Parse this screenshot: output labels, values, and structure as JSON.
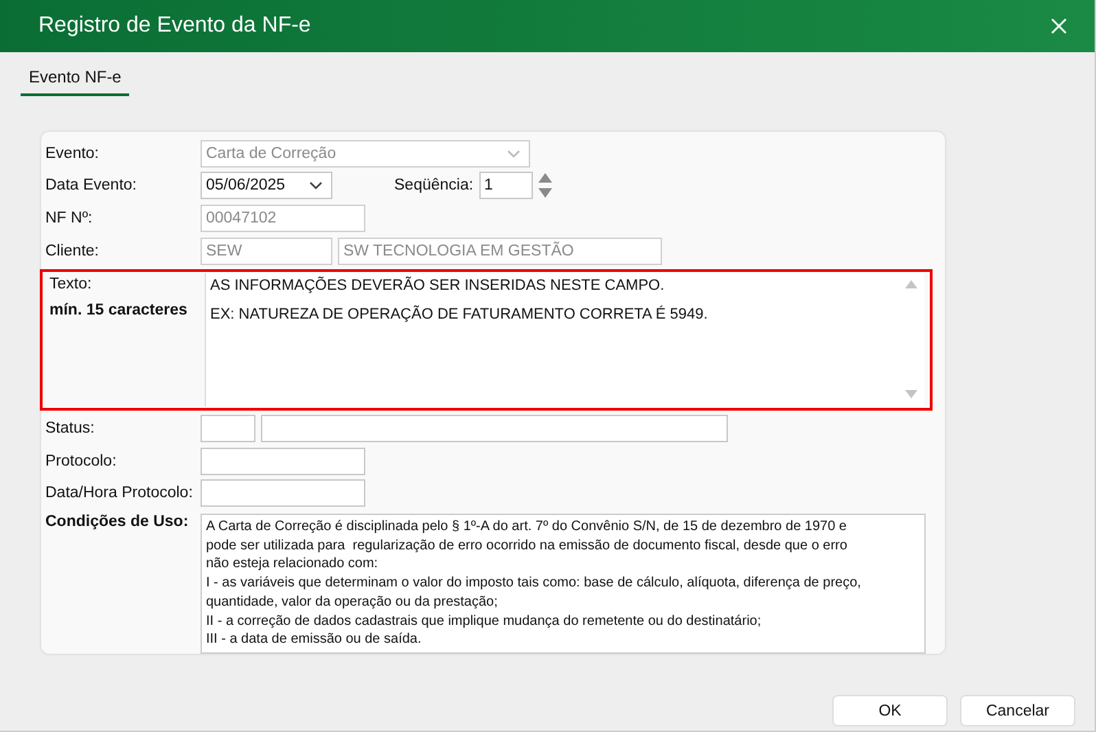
{
  "window": {
    "title": "Registro de Evento da NF-e"
  },
  "tabs": [
    {
      "label": "Evento NF-e",
      "selected": true
    }
  ],
  "rows_top": [
    {
      "label": "Evento:",
      "fields": [
        {
          "kind": "combo",
          "value": "Carta de Correção",
          "disabled": true
        }
      ]
    },
    {
      "label": "Data Evento:",
      "fields": [
        {
          "kind": "date",
          "value": "05/06/2025",
          "disabled": false
        },
        {
          "kind": "spin",
          "label": "Seqüência:",
          "value": "1",
          "disabled": false
        }
      ]
    },
    {
      "label": "NF Nº:",
      "fields": [
        {
          "kind": "text",
          "value": "00047102",
          "disabled": true
        }
      ]
    },
    {
      "label": "Cliente:",
      "fields": [
        {
          "kind": "text",
          "value": "SEW",
          "disabled": true
        },
        {
          "kind": "text",
          "value": "SW TECNOLOGIA EM GESTÃO",
          "disabled": true
        }
      ]
    }
  ],
  "texto": {
    "label": "Texto:",
    "hint": "mín. 15 caracteres",
    "highlighted": true,
    "lines": [
      "AS INFORMAÇÕES DEVERÃO SER INSERIDAS NESTE CAMPO.",
      "EX: NATUREZA DE OPERAÇÃO DE FATURAMENTO CORRETA É 5949."
    ]
  },
  "rows_bottom": [
    {
      "label": "Status:",
      "fields": [
        {
          "kind": "text"
        },
        {
          "kind": "text"
        }
      ]
    },
    {
      "label": "Protocolo:",
      "fields": [
        {
          "kind": "text"
        }
      ]
    },
    {
      "label": "Data/Hora Protocolo:",
      "fields": [
        {
          "kind": "text"
        }
      ]
    }
  ],
  "conditions": {
    "label": "Condições de Uso:",
    "text": "A Carta de Correção é disciplinada pelo § 1º-A do art. 7º do Convênio S/N, de 15 de dezembro de 1970 e\npode ser utilizada para  regularização de erro ocorrido na emissão de documento fiscal, desde que o erro\nnão esteja relacionado com:\nI - as variáveis que determinam o valor do imposto tais como: base de cálculo, alíquota, diferença de preço,\nquantidade, valor da operação ou da prestação;\nII - a correção de dados cadastrais que implique mudança do remetente ou do destinatário;\nIII - a data de emissão ou de saída."
  },
  "buttons": [
    {
      "label": "OK"
    },
    {
      "label": "Cancelar"
    }
  ]
}
